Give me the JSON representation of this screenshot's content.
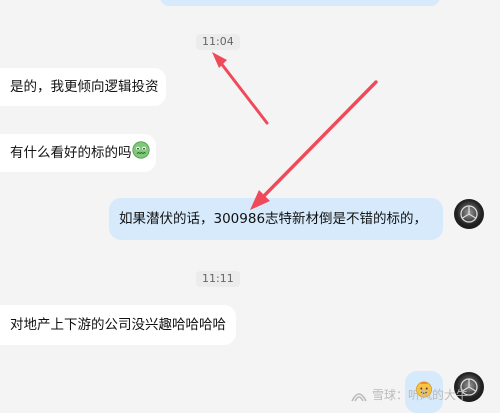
{
  "messages": {
    "prev_bubble_text": "",
    "time1": "11:04",
    "m1": "是的，我更倾向逻辑投资",
    "m2": "有什么看好的标的吗",
    "m2_emoji": "nervous-face",
    "m3": "如果潜伏的话，300986志特新材倒是不错的标的，",
    "time2": "11:11",
    "m4": "对地产上下游的公司没兴趣哈哈哈哈",
    "m5_emoji": "fire-face"
  },
  "watermark": {
    "text": "雪球：听风的大牛"
  },
  "colors": {
    "background": "#f4f4f4",
    "left_bubble": "#ffffff",
    "right_bubble": "#d6eafc",
    "arrow": "#f04a5a"
  }
}
